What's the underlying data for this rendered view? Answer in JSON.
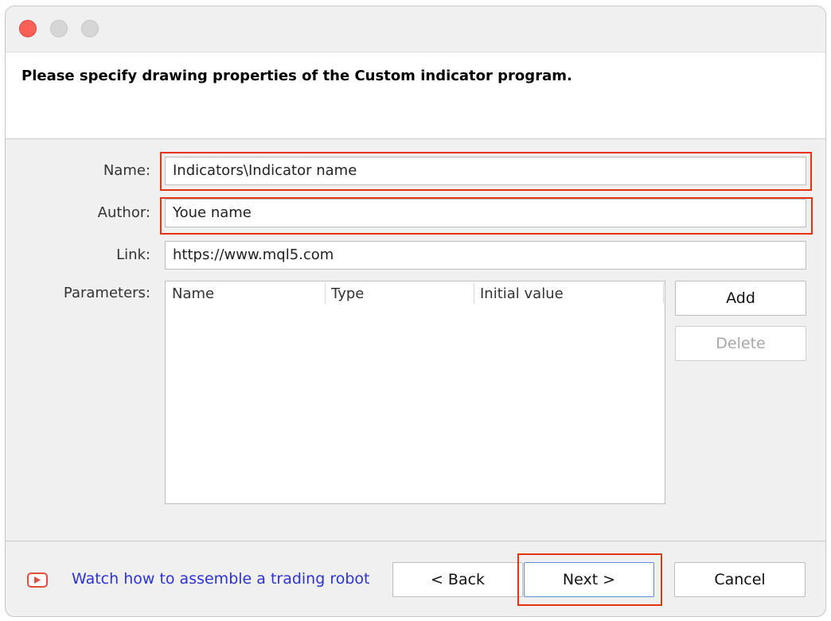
{
  "header": {
    "title": "Please specify drawing properties of the Custom indicator program."
  },
  "form": {
    "name_label": "Name:",
    "name_value": "Indicators\\Indicator name",
    "author_label": "Author:",
    "author_value": "Youe name",
    "link_label": "Link:",
    "link_value": "https://www.mql5.com",
    "parameters_label": "Parameters:"
  },
  "parameters_table": {
    "columns": [
      "Name",
      "Type",
      "Initial value"
    ],
    "rows": []
  },
  "buttons": {
    "add": "Add",
    "delete": "Delete",
    "back": "< Back",
    "next": "Next >",
    "cancel": "Cancel"
  },
  "footer": {
    "watch_link": "Watch how to assemble a trading robot"
  },
  "icons": {
    "close": "close-traffic-light",
    "minimize": "minimize-traffic-light",
    "maximize": "maximize-traffic-light",
    "video": "youtube-play-icon"
  },
  "colors": {
    "highlight": "#e63312",
    "link": "#2b33d9",
    "close_button": "#fe5f57"
  }
}
